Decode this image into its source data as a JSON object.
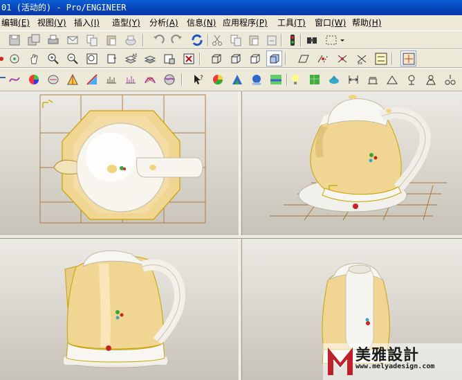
{
  "window": {
    "title": "01 (活动的) - Pro/ENGINEER"
  },
  "menubar": {
    "items": [
      {
        "label": "编辑",
        "key": "(E)"
      },
      {
        "label": "视图",
        "key": "(V)"
      },
      {
        "label": "插入",
        "key": "(I)"
      },
      {
        "label": "造型",
        "key": "(Y)"
      },
      {
        "label": "分析",
        "key": "(A)"
      },
      {
        "label": "信息",
        "key": "(N)"
      },
      {
        "label": "应用程序",
        "key": "(P)"
      },
      {
        "label": "工具",
        "key": "(T)"
      },
      {
        "label": "窗口",
        "key": "(W)"
      },
      {
        "label": "帮助",
        "key": "(H)"
      }
    ]
  },
  "colors": {
    "body": "#f0d590",
    "base": "#ececec",
    "grid": "#a86a2a",
    "titlebar": "#0a4fc8",
    "viewport_top": "#eceae4",
    "viewport_bottom": "#c7c3b8"
  },
  "icons": {
    "toolbar1": [
      "save-icon",
      "save-copy-icon",
      "print-icon",
      "send-mail-icon",
      "copy-icon",
      "paste-icon",
      "paste-special-icon",
      "undo-icon",
      "redo-icon",
      "regenerate-icon",
      "cut-icon",
      "copy-icon",
      "paste-icon",
      "traffic-light-icon",
      "find-icon",
      "selection-box-icon"
    ],
    "toolbar2": [
      "spin-center-icon",
      "orient-icon",
      "pan-icon",
      "zoom-in-icon",
      "zoom-out-icon",
      "refit-icon",
      "reorient-icon",
      "layers-icon",
      "model-display-icon",
      "close-window-icon",
      "wireframe-icon",
      "hidden-line-icon",
      "no-hidden-icon",
      "shading-icon",
      "datum-planes-icon",
      "datum-axes-icon",
      "datum-points-icon",
      "coordinate-systems-icon",
      "saved-views-icon"
    ],
    "toolbar3": [
      "curve-icon",
      "color-icon",
      "surface-icon",
      "reflection-icon",
      "draft-icon",
      "curvature-icon",
      "section-icon",
      "offset-icon",
      "deviation-icon",
      "dihedral-icon",
      "whats-this-icon",
      "appearance-icon",
      "scene-icon",
      "light-icon",
      "render-icon",
      "perspective-icon",
      "spotlight-icon",
      "texture-icon",
      "room-icon",
      "measure-icon",
      "distance-icon",
      "angle-icon",
      "area-icon",
      "mass-icon"
    ]
  },
  "watermark": {
    "logo_letter": "M",
    "brand_cn": "美雅設計",
    "url": "www.melyadesign.com"
  }
}
